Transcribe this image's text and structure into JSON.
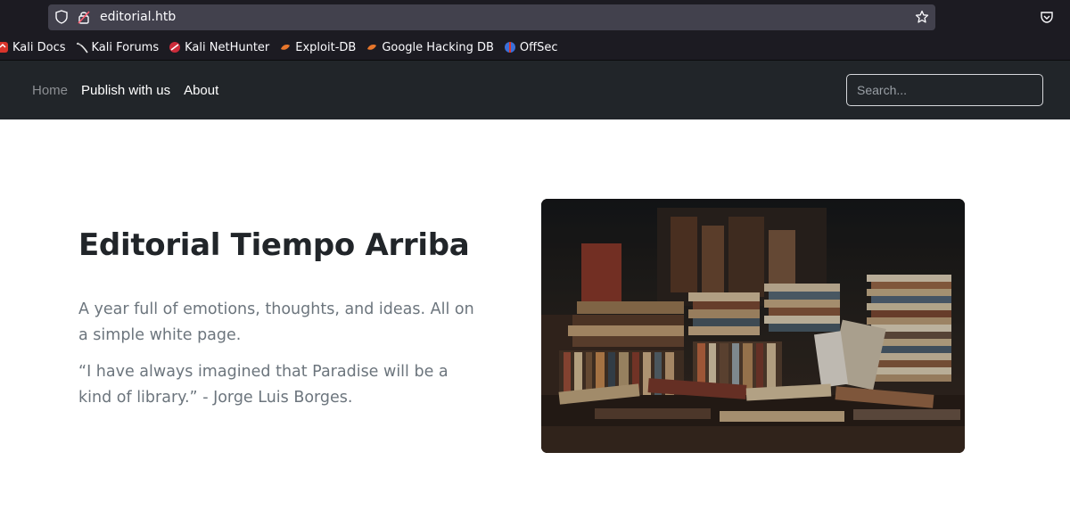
{
  "browser": {
    "url": "editorial.htb",
    "bookmarks": [
      {
        "label": "Kali Docs",
        "icon": "kali-docs-icon"
      },
      {
        "label": "Kali Forums",
        "icon": "kali-forums-icon"
      },
      {
        "label": "Kali NetHunter",
        "icon": "nethunter-icon"
      },
      {
        "label": "Exploit-DB",
        "icon": "exploit-db-icon"
      },
      {
        "label": "Google Hacking DB",
        "icon": "ghdb-icon"
      },
      {
        "label": "OffSec",
        "icon": "offsec-icon"
      }
    ]
  },
  "nav": {
    "home": "Home",
    "publish": "Publish with us",
    "about": "About",
    "search_placeholder": "Search..."
  },
  "hero": {
    "title": "Editorial Tiempo Arriba",
    "lead1": "A year full of emotions, thoughts, and ideas. All on a simple white page.",
    "lead2": "“I have always imagined that Paradise will be a kind of library.” - Jorge Luis Borges."
  },
  "colors": {
    "chrome_bg": "#1c1b22",
    "urlbar_bg": "#42414d",
    "navbar_bg": "#212529",
    "text_dark": "#212529",
    "text_muted": "#6c757d"
  }
}
